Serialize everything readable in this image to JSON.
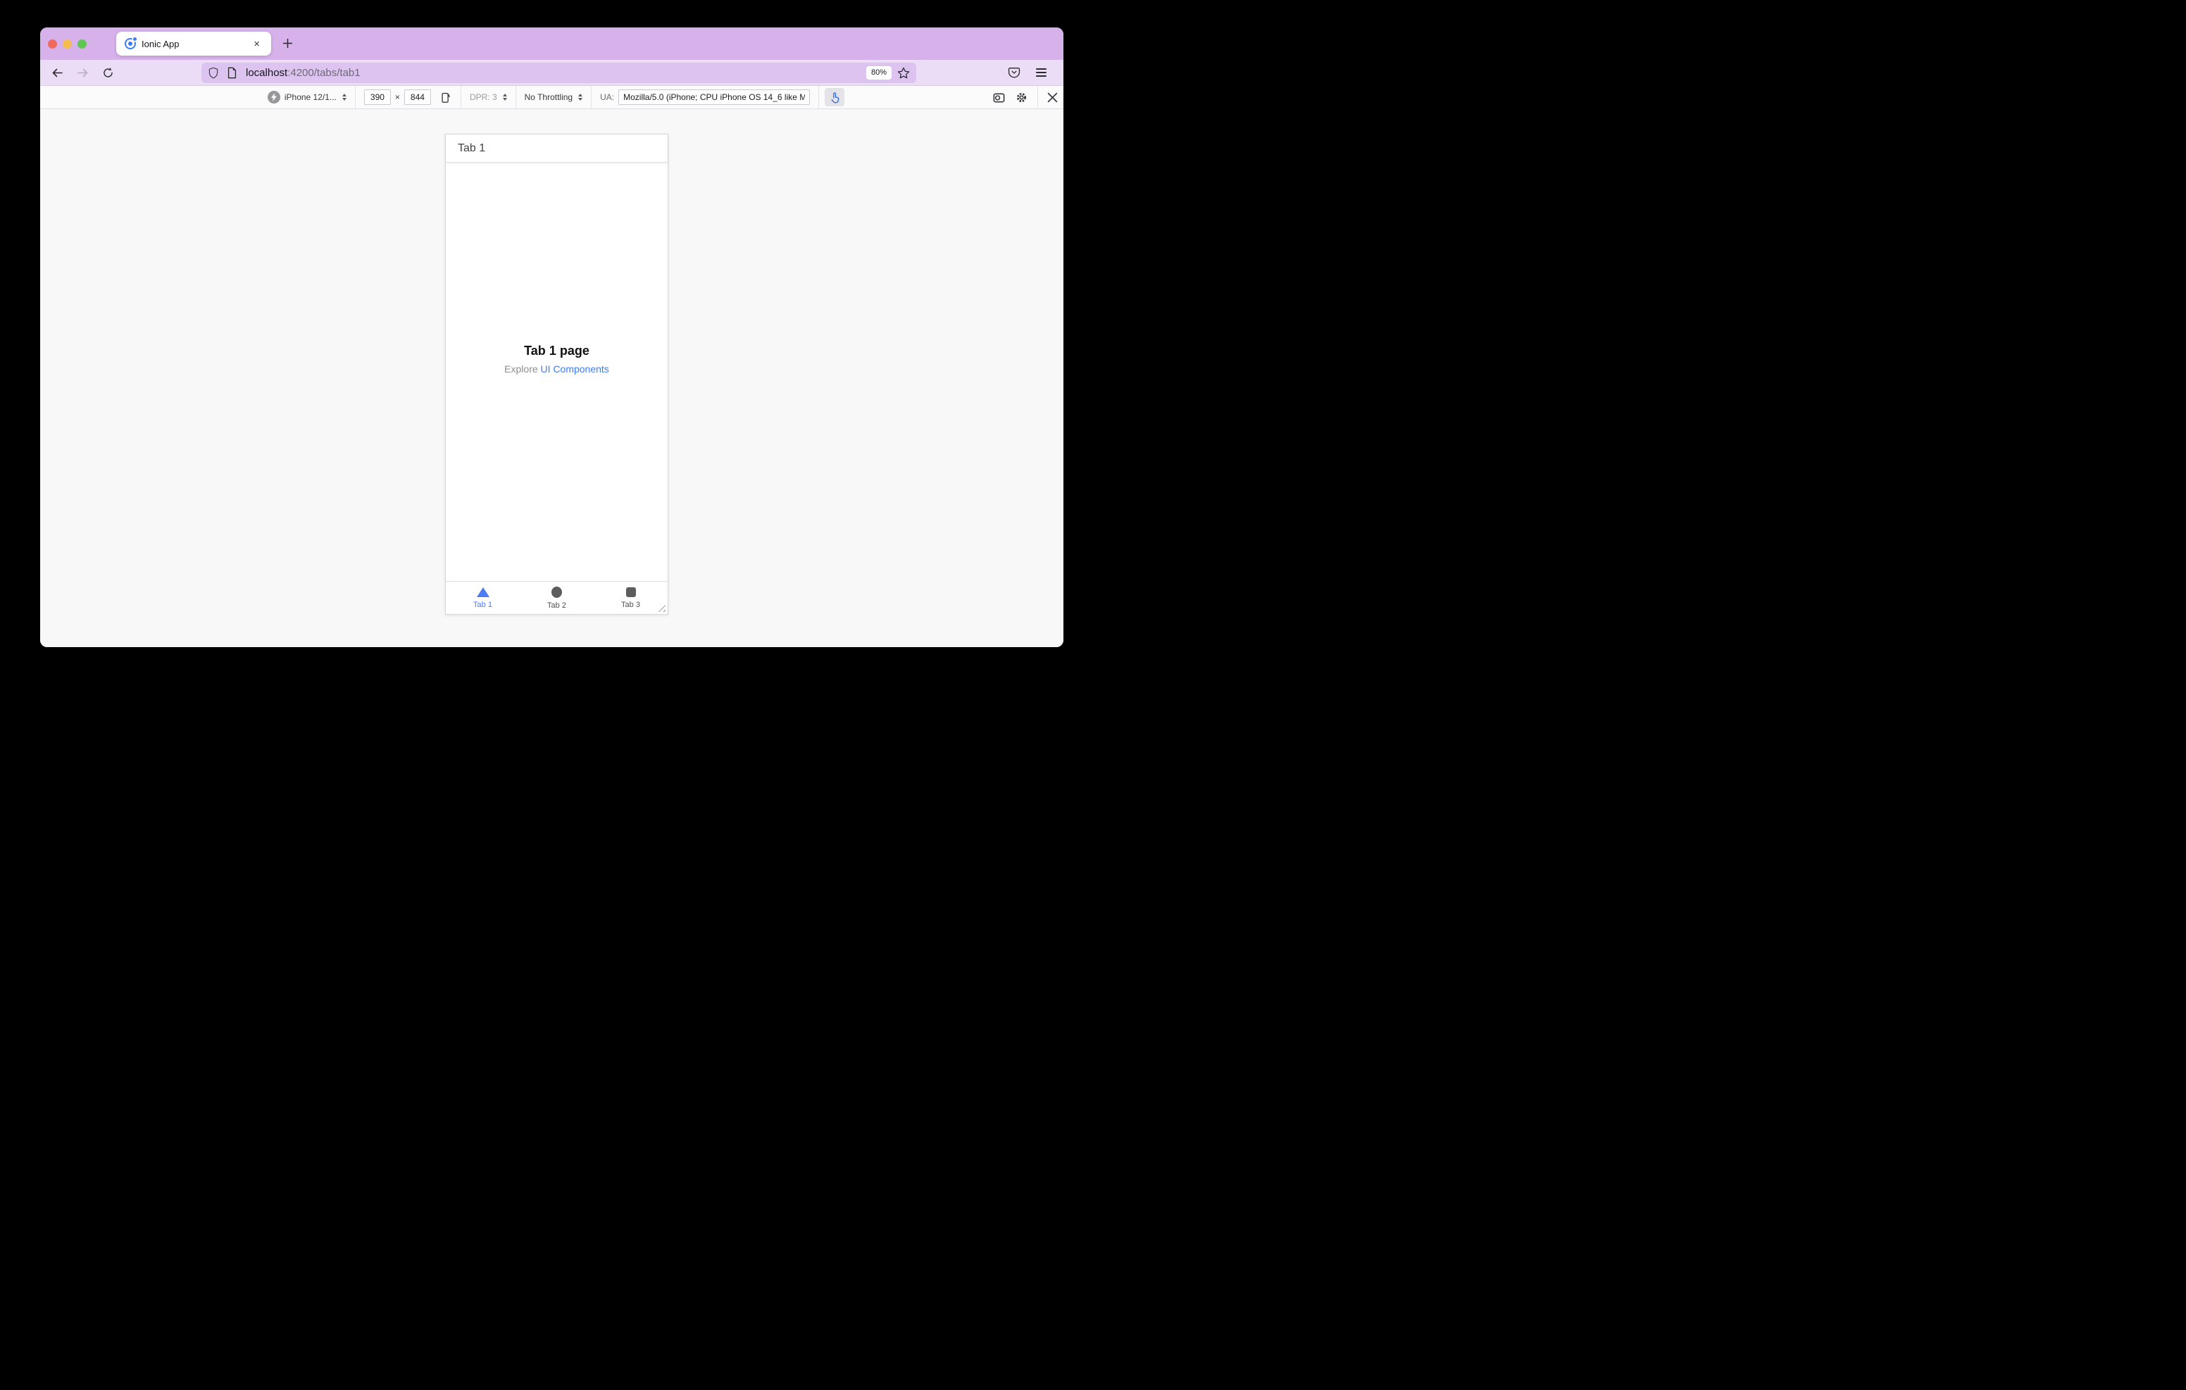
{
  "browser": {
    "tab_title": "Ionic App",
    "tab_close": "×",
    "new_tab": "+",
    "url_host": "localhost",
    "url_rest": ":4200/tabs/tab1",
    "zoom_level": "80%"
  },
  "rdm": {
    "device": "iPhone 12/1...",
    "viewport_width": "390",
    "dims_separator": "×",
    "viewport_height": "844",
    "dpr": "DPR: 3",
    "throttling": "No Throttling",
    "ua_label": "UA:",
    "ua_value": "Mozilla/5.0 (iPhone; CPU iPhone OS 14_6 like M"
  },
  "phone": {
    "header_title": "Tab 1",
    "content_title": "Tab 1 page",
    "content_text_prefix": "Explore ",
    "content_link": "UI Components",
    "tabs": [
      {
        "label": "Tab 1",
        "icon": "triangle-icon",
        "active": true
      },
      {
        "label": "Tab 2",
        "icon": "ellipse-icon",
        "active": false
      },
      {
        "label": "Tab 3",
        "icon": "square-icon",
        "active": false
      }
    ]
  },
  "colors": {
    "titlebar": "#d6b1ea",
    "navbar": "#ebddf6",
    "urlbar": "#dcc3f0",
    "link_blue": "#3d7cf7",
    "tab_active_blue": "#4d7cf3",
    "touch_icon_blue": "#2e6be5"
  }
}
